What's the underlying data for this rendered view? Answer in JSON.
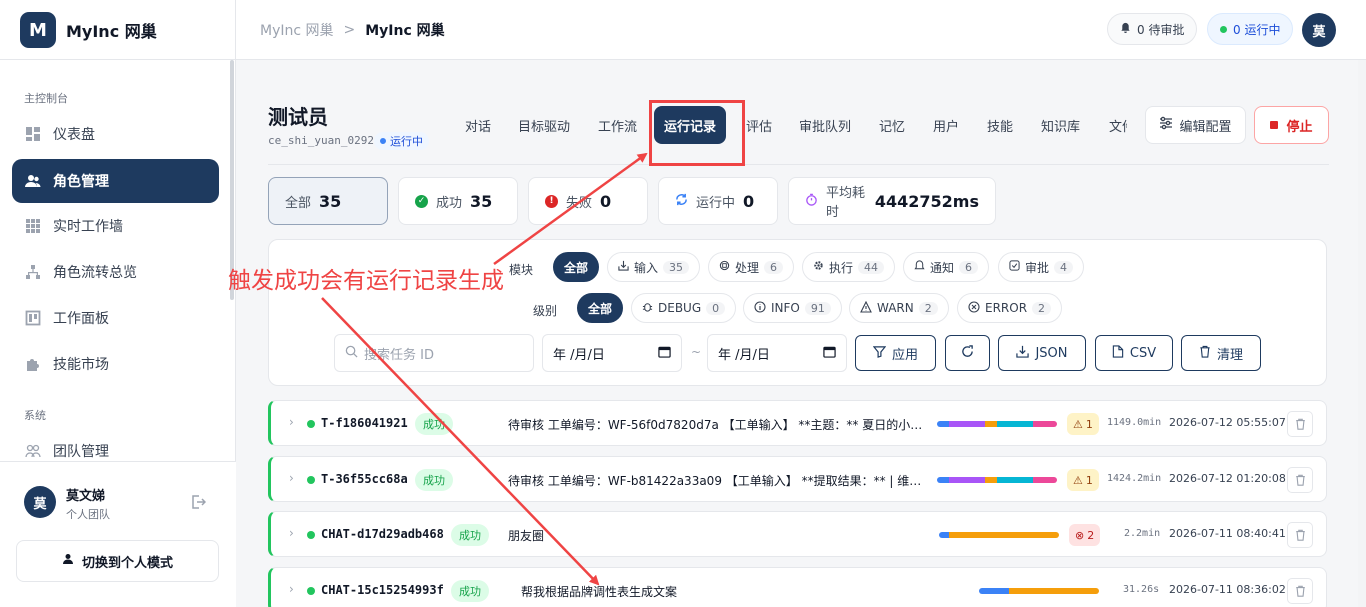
{
  "brand": {
    "logo": "M",
    "name": "MyInc 网巢"
  },
  "sidebar": {
    "group_main": "主控制台",
    "items": [
      {
        "label": "仪表盘",
        "icon": "dashboard-icon"
      },
      {
        "label": "角色管理",
        "icon": "users-icon",
        "active": true
      },
      {
        "label": "实时工作墙",
        "icon": "grid-icon"
      },
      {
        "label": "角色流转总览",
        "icon": "flow-icon"
      },
      {
        "label": "工作面板",
        "icon": "board-icon"
      },
      {
        "label": "技能市场",
        "icon": "puzzle-icon"
      }
    ],
    "group_system": "系统",
    "system_items": [
      {
        "label": "团队管理",
        "icon": "team-icon"
      }
    ],
    "user": {
      "avatar": "莫",
      "name": "莫文娣",
      "team": "个人团队"
    },
    "switch_label": "切换到个人模式"
  },
  "header": {
    "breadcrumb_root": "MyInc 网巢",
    "breadcrumb_sep": ">",
    "breadcrumb_current": "MyInc 网巢",
    "pending_label": "0 待审批",
    "running_label": "0 运行中",
    "avatar": "莫"
  },
  "agent": {
    "title": "测试员",
    "id": "ce_shi_yuan_0292",
    "status": "运行中"
  },
  "tabs": [
    "对话",
    "目标驱动",
    "工作流",
    "运行记录",
    "评估",
    "审批队列",
    "记忆",
    "用户",
    "技能",
    "知识库",
    "文件"
  ],
  "actions": {
    "edit_label": "编辑配置",
    "stop_label": "停止"
  },
  "stats": [
    {
      "label": "全部",
      "value": "35"
    },
    {
      "label": "成功",
      "value": "35"
    },
    {
      "label": "失败",
      "value": "0"
    },
    {
      "label": "运行中",
      "value": "0"
    },
    {
      "label": "平均耗时",
      "value": "4442752ms"
    }
  ],
  "filters": {
    "module_label": "模块",
    "modules": [
      {
        "label": "全部"
      },
      {
        "label": "输入",
        "count": "35"
      },
      {
        "label": "处理",
        "count": "6"
      },
      {
        "label": "执行",
        "count": "44"
      },
      {
        "label": "通知",
        "count": "6"
      },
      {
        "label": "审批",
        "count": "4"
      }
    ],
    "level_label": "级别",
    "levels": [
      {
        "label": "全部"
      },
      {
        "label": "DEBUG",
        "count": "0"
      },
      {
        "label": "INFO",
        "count": "91"
      },
      {
        "label": "WARN",
        "count": "2"
      },
      {
        "label": "ERROR",
        "count": "2"
      }
    ],
    "search_placeholder": "搜索任务 ID",
    "date_from": "年 /月/日",
    "date_sep": "~",
    "date_to": "年 /月/日",
    "apply_label": "应用",
    "json_label": "JSON",
    "csv_label": "CSV",
    "clear_label": "清理"
  },
  "runs": [
    {
      "id": "T-f186041921",
      "status": "成功",
      "text": "待审核 工单编号：WF-56f0d7820d7a 【工单输入】 **主题：** 夏日的小舒…",
      "warn": "1",
      "duration": "1149.0min",
      "time": "2026-07-12 05:55:07"
    },
    {
      "id": "T-36f55cc68a",
      "status": "成功",
      "text": "待审核 工单编号：WF-b81422a33a09 【工单输入】 **提取结果：** | 维度 …",
      "warn": "1",
      "duration": "1424.2min",
      "time": "2026-07-12 01:20:08"
    },
    {
      "id": "CHAT-d17d29adb468",
      "status": "成功",
      "text": "朋友圈",
      "error": "2",
      "duration": "2.2min",
      "time": "2026-07-11 08:40:41"
    },
    {
      "id": "CHAT-15c15254993f",
      "status": "成功",
      "text": "帮我根据品牌调性表生成文案",
      "duration": "31.26s",
      "time": "2026-07-11 08:36:02"
    }
  ],
  "annotation": {
    "text": "触发成功会有运行记录生成"
  },
  "colors": {
    "primary": "#1e3a5f",
    "success": "#22c55e",
    "danger": "#ef4444",
    "annotation": "#ef4444"
  }
}
